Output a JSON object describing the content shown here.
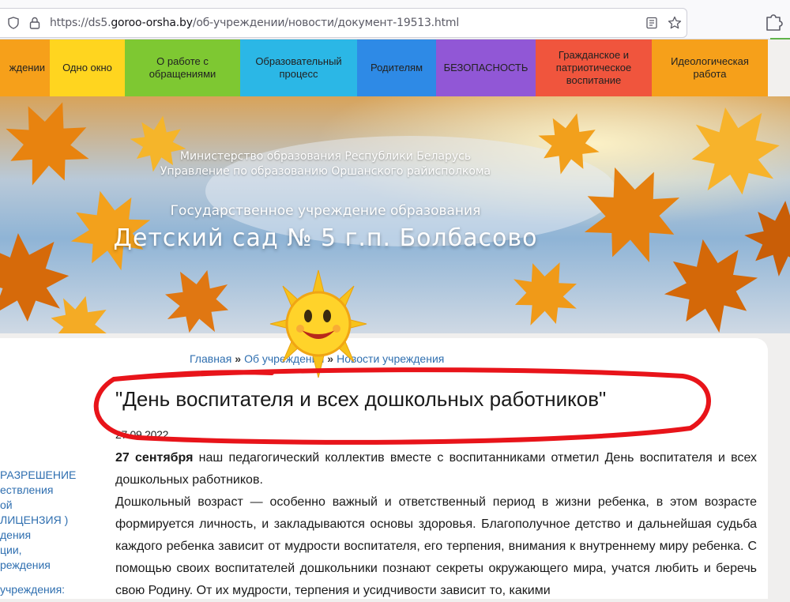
{
  "browser": {
    "url_prefix": "https://ds5.",
    "url_host": "goroo-orsha.by",
    "url_path": "/об-учреждении/новости/документ-19513.html"
  },
  "nav": {
    "items": [
      {
        "label": "ждении",
        "color": "#f6a01a",
        "white": false
      },
      {
        "label": "Одно окно",
        "color": "#ffd51f",
        "white": false
      },
      {
        "label": "О работе с обращениями",
        "color": "#7ec832",
        "white": false
      },
      {
        "label": "Образовательный процесс",
        "color": "#2bb7e6",
        "white": false
      },
      {
        "label": "Родителям",
        "color": "#2e8ae6",
        "white": false
      },
      {
        "label": "БЕЗОПАСНОСТЬ",
        "color": "#9157d6",
        "white": false
      },
      {
        "label": "Гражданское и патриотическое воспитание",
        "color": "#f0553d",
        "white": false
      },
      {
        "label": "Идеологическая работа",
        "color": "#f6a01a",
        "white": false
      }
    ]
  },
  "header": {
    "ministry_line1": "Министерство образования Республики Беларусь",
    "ministry_line2": "Управление по образованию Оршанского райисполкома",
    "institution": "Государственное учреждение образования",
    "kindergarten": "Детский сад № 5 г.п. Болбасово"
  },
  "breadcrumb": {
    "home": "Главная",
    "separator": "»",
    "section": "Об учреждении",
    "subsection": "Новости учреждения"
  },
  "article": {
    "title": "\"День воспитателя и всех дошкольных работников\"",
    "date": "27.09.2022",
    "p1_bold": "27 сентября",
    "p1_rest": " наш педагогический коллектив вместе с воспитанниками отметил День воспитателя и всех дошкольных работников.",
    "p2": "Дошкольный возраст — особенно важный и ответственный период в жизни ребенка, в этом возрасте формируется личность, и закладываются основы здоровья. Благополучное детство и дальнейшая судьба каждого ребенка зависит от мудрости воспитателя, его терпения, внимания к внутреннему миру ребенка. С помощью своих воспитателей дошкольники познают секреты окружающего мира, учатся любить и беречь свою Родину. От их мудрости, терпения и усидчивости зависит то, какими"
  },
  "sidebar": {
    "lines": [
      "РАЗРЕШЕНИЕ",
      "ествления",
      "ой",
      " ЛИЦЕНЗИЯ )",
      "дения",
      "ции,",
      "реждения"
    ],
    "last": "учреждения:"
  },
  "colors": {
    "link": "#2f6fb0",
    "annotation": "#e8141a"
  }
}
